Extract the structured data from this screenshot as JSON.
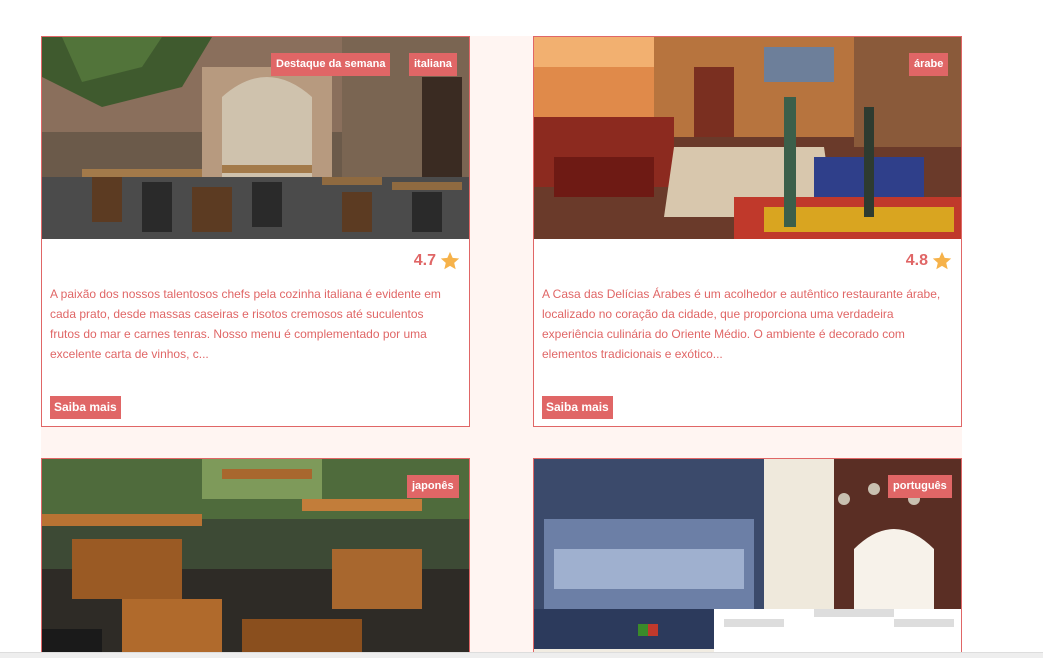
{
  "colors": {
    "accent": "#e06666",
    "section_bg": "#fff5f2",
    "star": "#f6b24a"
  },
  "cards": [
    {
      "badges": [
        "Destaque da semana",
        "italiana"
      ],
      "rating": "4.7",
      "description": "A paixão dos nossos talentosos chefs pela cozinha italiana é evidente em cada prato, desde massas caseiras e risotos cremosos até suculentos frutos do mar e carnes tenras. Nosso menu é complementado por uma excelente carta de vinhos, c...",
      "button": "Saiba mais"
    },
    {
      "badges": [
        "árabe"
      ],
      "rating": "4.8",
      "description": "A Casa das Delícias Árabes é um acolhedor e autêntico restaurante árabe, localizado no coração da cidade, que proporciona uma verdadeira experiência culinária do Oriente Médio. O ambiente é decorado com elementos tradicionais e exótico...",
      "button": "Saiba mais"
    },
    {
      "badges": [
        "japonês"
      ]
    },
    {
      "badges": [
        "português"
      ]
    }
  ]
}
